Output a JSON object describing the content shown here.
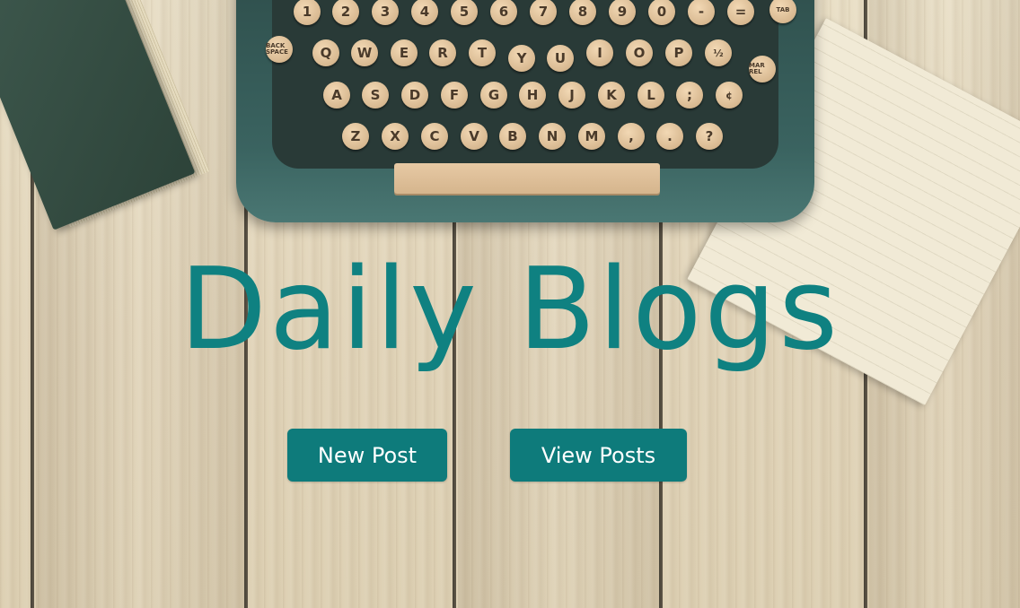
{
  "hero": {
    "title": "Daily Blogs"
  },
  "actions": {
    "new_post_label": "New Post",
    "view_posts_label": "View Posts"
  },
  "background": {
    "typewriter_keys": {
      "row_numbers": [
        "1",
        "2",
        "3",
        "4",
        "5",
        "6",
        "7",
        "8",
        "9",
        "0",
        "-",
        "="
      ],
      "row_qwerty": [
        "Q",
        "W",
        "E",
        "R",
        "T",
        "Y",
        "U",
        "I",
        "O",
        "P",
        "½"
      ],
      "row_asdf": [
        "A",
        "S",
        "D",
        "F",
        "G",
        "H",
        "J",
        "K",
        "L",
        ";",
        "¢"
      ],
      "row_zxcv": [
        "Z",
        "X",
        "C",
        "V",
        "B",
        "N",
        "M",
        ",",
        ".",
        "?"
      ],
      "back_space": "BACK SPACE",
      "tab": "TAB",
      "mar_rel": "MAR REL"
    }
  },
  "theme": {
    "accent": "#0e7b7b",
    "title_color": "#0f8181",
    "button_text": "#ffffff"
  }
}
